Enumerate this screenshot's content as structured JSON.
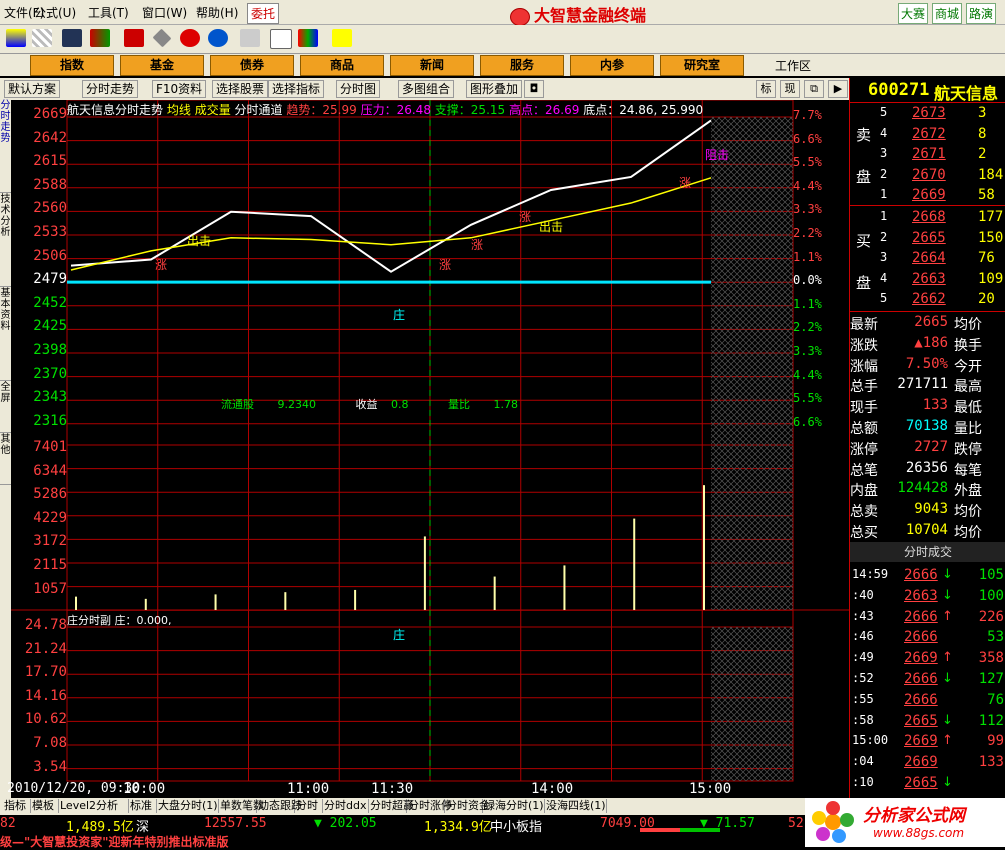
{
  "menubar": {
    "items": [
      "文件(F)",
      "公式(U)",
      "工具(T)",
      "窗口(W)",
      "帮助(H)"
    ],
    "weituo": "委托",
    "brand": "大智慧金融终端",
    "right_buttons": [
      "大赛",
      "商城",
      "路演"
    ]
  },
  "nav": {
    "buttons": [
      "指数",
      "基金",
      "债券",
      "商品",
      "新闻",
      "服务",
      "内参",
      "研究室"
    ],
    "workarea": "工作区"
  },
  "subtabs": {
    "items": [
      "默认方案",
      "分时走势",
      "F10资料",
      "选择股票",
      "选择指标",
      "分时图",
      "多图组合",
      "图形叠加"
    ],
    "right_items": [
      "标",
      "现"
    ]
  },
  "left_vertical_tabs": [
    "分时走势",
    "技术分析",
    "基本资料",
    "全屏",
    "其他"
  ],
  "chart": {
    "header_title": "航天信息分时走势",
    "header_items": [
      {
        "label": "均线",
        "color": "#ffff00"
      },
      {
        "label": "成交量",
        "color": "#ffff00"
      },
      {
        "label": "分时通道",
        "color": "#ffffff"
      }
    ],
    "header_values": [
      {
        "label": "趋势：",
        "value": "25.99",
        "color": "#ff4040"
      },
      {
        "label": "压力：",
        "value": "26.48",
        "color": "#ff00ff"
      },
      {
        "label": "支撑：",
        "value": "25.15",
        "color": "#00e000"
      },
      {
        "label": "高点：",
        "value": "26.69",
        "color": "#ff00ff"
      },
      {
        "label": "底点：",
        "value": "24.86, 25.990",
        "color": "#ffffff"
      }
    ],
    "price_axis": [
      {
        "v": "2669",
        "c": "red"
      },
      {
        "v": "2642",
        "c": "red"
      },
      {
        "v": "2615",
        "c": "red"
      },
      {
        "v": "2588",
        "c": "red"
      },
      {
        "v": "2560",
        "c": "red"
      },
      {
        "v": "2533",
        "c": "red"
      },
      {
        "v": "2506",
        "c": "red"
      },
      {
        "v": "2479",
        "c": "white"
      },
      {
        "v": "2452",
        "c": "green"
      },
      {
        "v": "2425",
        "c": "green"
      },
      {
        "v": "2398",
        "c": "green"
      },
      {
        "v": "2370",
        "c": "green"
      },
      {
        "v": "2343",
        "c": "green"
      },
      {
        "v": "2316",
        "c": "green"
      }
    ],
    "pct_axis": [
      {
        "v": "7.7%",
        "c": "red"
      },
      {
        "v": "6.6%",
        "c": "red"
      },
      {
        "v": "5.5%",
        "c": "red"
      },
      {
        "v": "4.4%",
        "c": "red"
      },
      {
        "v": "3.3%",
        "c": "red"
      },
      {
        "v": "2.2%",
        "c": "red"
      },
      {
        "v": "1.1%",
        "c": "red"
      },
      {
        "v": "0.0%",
        "c": "white"
      },
      {
        "v": "1.1%",
        "c": "green"
      },
      {
        "v": "2.2%",
        "c": "green"
      },
      {
        "v": "3.3%",
        "c": "green"
      },
      {
        "v": "4.4%",
        "c": "green"
      },
      {
        "v": "5.5%",
        "c": "green"
      },
      {
        "v": "6.6%",
        "c": "green"
      }
    ],
    "volume_axis": [
      "7401",
      "6344",
      "5286",
      "4229",
      "3172",
      "2115",
      "1057"
    ],
    "info_line": {
      "float_label": "流通股",
      "float_value": "9.2340",
      "eps_label": "收益",
      "eps_value": "0.8",
      "volratio_label": "量比",
      "volratio_value": "1.78"
    },
    "sub_axis": [
      "24.78",
      "21.24",
      "17.70",
      "14.16",
      "10.62",
      "7.08",
      "3.54"
    ],
    "sub_title": "庄分时副 庄：0.000,",
    "time_axis": [
      "2010/12/20, 09:30",
      "10:00",
      "11:00",
      "11:30",
      "14:00",
      "15:00"
    ],
    "annotations": {
      "chuji": "出击",
      "zhang": "涨",
      "zuji": "阻击",
      "zhuang": "庄"
    }
  },
  "chart_data": {
    "type": "line",
    "title": "航天信息分时走势",
    "x": [
      "09:30",
      "10:00",
      "10:30",
      "11:00",
      "11:30",
      "13:30",
      "14:00",
      "14:30",
      "15:00"
    ],
    "series": [
      {
        "name": "",
        "values": [
          24.98,
          25.05,
          25.6,
          25.55,
          24.91,
          25.45,
          25.85,
          26.0,
          26.65
        ],
        "color": "#ffffff"
      },
      {
        "name": "均线",
        "values": [
          24.93,
          25.15,
          25.3,
          25.28,
          25.22,
          25.3,
          25.5,
          25.7,
          25.99
        ],
        "color": "#ffff00"
      }
    ],
    "volume": [
      600,
      500,
      700,
      800,
      900,
      3300,
      1500,
      2000,
      4100,
      5600
    ],
    "ylim": [
      23.16,
      26.69
    ],
    "prev_close": 24.79
  },
  "quote": {
    "code": "600271",
    "name": "航天信息",
    "sell": [
      {
        "idx": "5",
        "price": "2673",
        "vol": "3"
      },
      {
        "idx": "4",
        "price": "2672",
        "vol": "8"
      },
      {
        "idx": "3",
        "price": "2671",
        "vol": "2"
      },
      {
        "idx": "2",
        "price": "2670",
        "vol": "184"
      },
      {
        "idx": "1",
        "price": "2669",
        "vol": "58"
      }
    ],
    "buy": [
      {
        "idx": "1",
        "price": "2668",
        "vol": "177"
      },
      {
        "idx": "2",
        "price": "2665",
        "vol": "150"
      },
      {
        "idx": "3",
        "price": "2664",
        "vol": "76"
      },
      {
        "idx": "4",
        "price": "2663",
        "vol": "109"
      },
      {
        "idx": "5",
        "price": "2662",
        "vol": "20"
      }
    ],
    "sell_label": [
      "卖",
      "盘"
    ],
    "buy_label": [
      "买",
      "盘"
    ],
    "stats": [
      {
        "l1": "最新",
        "v1": "2665",
        "c1": "red",
        "l2": "均价"
      },
      {
        "l1": "涨跌",
        "v1": "▲186",
        "c1": "red",
        "l2": "换手"
      },
      {
        "l1": "涨幅",
        "v1": "7.50%",
        "c1": "red",
        "l2": "今开"
      },
      {
        "l1": "总手",
        "v1": "271711",
        "c1": "white",
        "l2": "最高"
      },
      {
        "l1": "现手",
        "v1": "133",
        "c1": "red",
        "l2": "最低"
      },
      {
        "l1": "总额",
        "v1": "70138",
        "c1": "cyan",
        "l2": "量比"
      },
      {
        "l1": "涨停",
        "v1": "2727",
        "c1": "red",
        "l2": "跌停"
      },
      {
        "l1": "总笔",
        "v1": "26356",
        "c1": "white",
        "l2": "每笔"
      },
      {
        "l1": "内盘",
        "v1": "124428",
        "c1": "green",
        "l2": "外盘"
      },
      {
        "l1": "总卖",
        "v1": "9043",
        "c1": "yellow",
        "l2": "均价"
      },
      {
        "l1": "总买",
        "v1": "10704",
        "c1": "yellow",
        "l2": "均价"
      }
    ],
    "trades_title": "分时成交",
    "trades": [
      {
        "t": "14:59",
        "p": "2666",
        "a": "↓",
        "ac": "green",
        "v": "105",
        "vc": "green"
      },
      {
        "t": ":40",
        "p": "2663",
        "a": "↓",
        "ac": "green",
        "v": "100",
        "vc": "green"
      },
      {
        "t": ":43",
        "p": "2666",
        "a": "↑",
        "ac": "red",
        "v": "226",
        "vc": "red"
      },
      {
        "t": ":46",
        "p": "2666",
        "a": "",
        "ac": "red",
        "v": "53",
        "vc": "green"
      },
      {
        "t": ":49",
        "p": "2669",
        "a": "↑",
        "ac": "red",
        "v": "358",
        "vc": "red"
      },
      {
        "t": ":52",
        "p": "2666",
        "a": "↓",
        "ac": "green",
        "v": "127",
        "vc": "green"
      },
      {
        "t": ":55",
        "p": "2666",
        "a": "",
        "ac": "red",
        "v": "76",
        "vc": "green"
      },
      {
        "t": ":58",
        "p": "2665",
        "a": "↓",
        "ac": "green",
        "v": "112",
        "vc": "green"
      },
      {
        "t": "15:00",
        "p": "2669",
        "a": "↑",
        "ac": "red",
        "v": "99",
        "vc": "red"
      },
      {
        "t": ":04",
        "p": "2669",
        "a": "",
        "ac": "red",
        "v": "133",
        "vc": "red"
      },
      {
        "t": ":10",
        "p": "2665",
        "a": "↓",
        "ac": "green",
        "v": "",
        "vc": "green"
      }
    ]
  },
  "bottom_tabs": [
    "指标",
    "模板",
    "Level2分析",
    "标准",
    "大盘分时(1)",
    "单数笔数",
    "动态跟踪",
    "分时",
    "分时ddx",
    "分时超赢",
    "分时涨停",
    "分时资金",
    "绿海分时(1)",
    "没海四线(1)"
  ],
  "status": {
    "a": "82",
    "b": "1,489.5亿",
    "c": "深",
    "d": "12557.55",
    "e": "▼ 202.05",
    "f": "1,334.9亿",
    "g": "中小板指",
    "h": "7049.00",
    "i": "▼ 71.57",
    "j": "52"
  },
  "ticker": "级—\"大智慧投资家\"迎新年特别推出标准版",
  "corner_brand": {
    "name": "分析家公式网",
    "url": "www.88gs.com"
  },
  "colors": {
    "up": "#ff4040",
    "down": "#00e000",
    "grid": "#b00000",
    "price": "#ffffff",
    "avg": "#ffff00"
  }
}
